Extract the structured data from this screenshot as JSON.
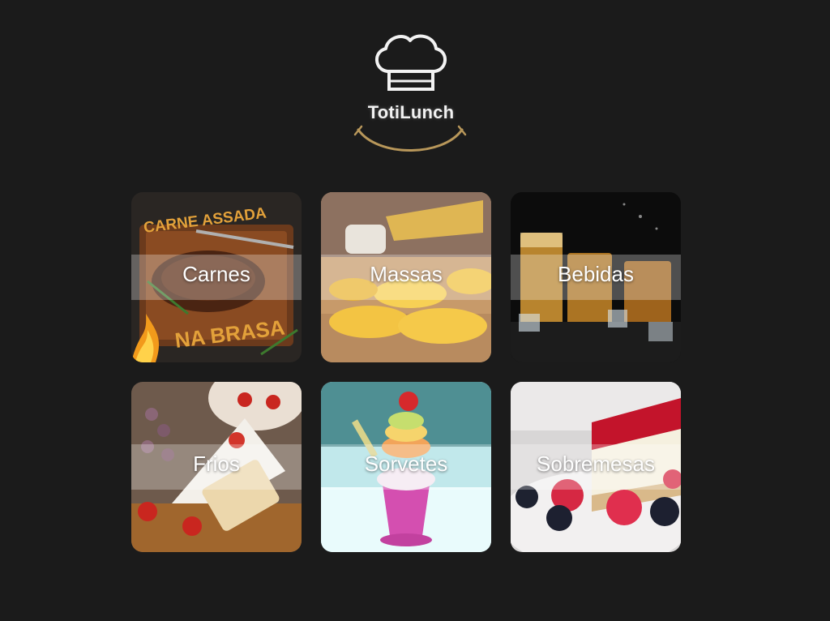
{
  "brand": {
    "name": "TotiLunch",
    "logo_icon": "chef-hat-icon",
    "accent_color": "#b8975a"
  },
  "categories": [
    {
      "label": "Carnes",
      "image_text_top": "CARNE ASSADA",
      "image_text_bottom": "NA BRASA"
    },
    {
      "label": "Massas"
    },
    {
      "label": "Bebidas"
    },
    {
      "label": "Frios"
    },
    {
      "label": "Sorvetes"
    },
    {
      "label": "Sobremesas"
    }
  ]
}
